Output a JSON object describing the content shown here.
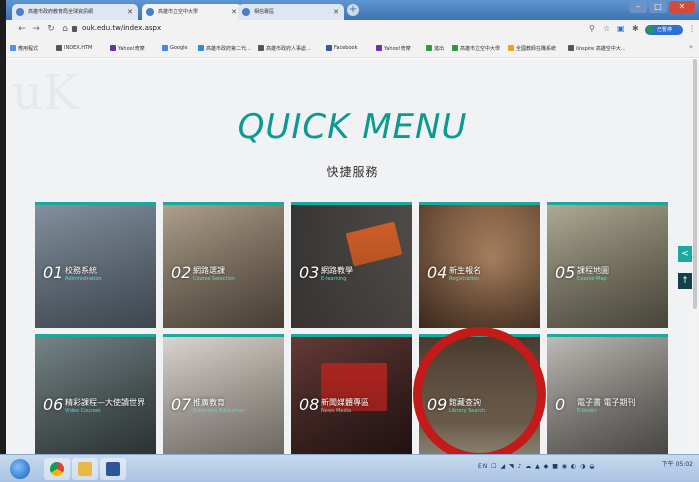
{
  "browser": {
    "tabs": [
      {
        "label": "高雄市政府教育局全球資訊網",
        "active": false
      },
      {
        "label": "高雄市立空中大學",
        "active": true
      },
      {
        "label": "相信專區",
        "active": false
      }
    ],
    "url": "ouk.edu.tw/index.aspx",
    "profile_label": "已暫停",
    "bookmarks": [
      {
        "label": "應用程式",
        "color": "#5b8def"
      },
      {
        "label": "INDEX.HTM",
        "color": "#555555"
      },
      {
        "label": "Yahoo!奇摩",
        "color": "#6b2fa8"
      },
      {
        "label": "Google",
        "color": "#4285f4"
      },
      {
        "label": "高雄市政府第二代...",
        "color": "#2a8bd6"
      },
      {
        "label": "高雄市政府人事處...",
        "color": "#555555"
      },
      {
        "label": "Facebook",
        "color": "#3b5998"
      },
      {
        "label": "Yahoo!奇摩",
        "color": "#6b2fa8"
      },
      {
        "label": "進出",
        "color": "#2d9a3f"
      },
      {
        "label": "高雄市立空中大學",
        "color": "#2d9a3f"
      },
      {
        "label": "全國教師在職系統",
        "color": "#f2a01a"
      },
      {
        "label": "iInspire 高雄空中大...",
        "color": "#555555"
      }
    ]
  },
  "page": {
    "title": "QUICK MENU",
    "subtitle": "快捷服務",
    "cards": [
      {
        "num": "01",
        "label": "校務系統",
        "sub": "Administration",
        "bg": "#6f7d8a"
      },
      {
        "num": "02",
        "label": "網路選課",
        "sub": "Course Selection",
        "bg": "#8a7a68"
      },
      {
        "num": "03",
        "label": "網路教學",
        "sub": "E-learning",
        "bg": "#4d4a47"
      },
      {
        "num": "04",
        "label": "新生報名",
        "sub": "Registration",
        "bg": "#7c5a43"
      },
      {
        "num": "05",
        "label": "課程地圖",
        "sub": "Course Map",
        "bg": "#8e8a77"
      },
      {
        "num": "06",
        "label": "精彩課程—大使讀世界",
        "sub": "Video Courses",
        "bg": "#5e6c6f"
      },
      {
        "num": "07",
        "label": "推廣教育",
        "sub": "Extension Education",
        "bg": "#c8c1ba"
      },
      {
        "num": "08",
        "label": "新聞媒體專區",
        "sub": "News Media",
        "bg": "#5a3431"
      },
      {
        "num": "09",
        "label": "館藏查詢",
        "sub": "Library Search",
        "bg": "#6a5846"
      },
      {
        "num": "0",
        "label": "電子書 電子期刊",
        "sub": "E-books",
        "bg": "#8e8b86"
      }
    ]
  },
  "taskbar": {
    "tray_text": "EN ☐ ◢ ◥ ♪ ☁ ▲ ◆ ■ ◉ ◐ ◑ ◒",
    "clock_time": "下午 05:02"
  }
}
